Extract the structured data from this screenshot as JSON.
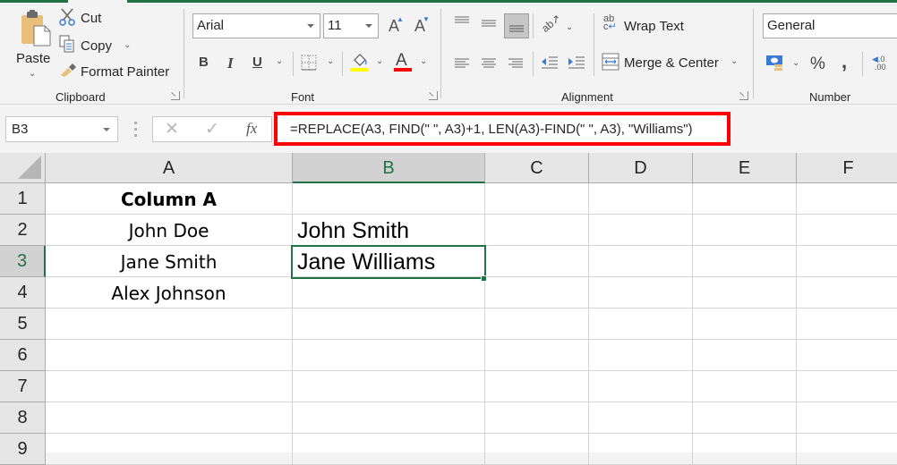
{
  "ribbon": {
    "clipboard": {
      "label": "Clipboard",
      "paste": "Paste",
      "cut": "Cut",
      "copy": "Copy",
      "format_painter": "Format Painter"
    },
    "font": {
      "label": "Font",
      "font_name": "Arial",
      "font_size": "11",
      "bold": "B",
      "italic": "I",
      "underline": "U",
      "grow": "A",
      "shrink": "A",
      "font_color_glyph": "A",
      "fill_color": "#ffff00",
      "font_color": "#ff0000"
    },
    "alignment": {
      "label": "Alignment",
      "wrap_text": "Wrap Text",
      "merge_center": "Merge & Center"
    },
    "number": {
      "label": "Number",
      "format": "General",
      "percent": "%",
      "comma": ",",
      "increase_decimal": ".00"
    }
  },
  "formula_bar": {
    "name_box": "B3",
    "cancel": "✕",
    "enter": "✓",
    "fx": "fx",
    "formula": "=REPLACE(A3, FIND(\" \", A3)+1, LEN(A3)-FIND(\" \", A3), \"Williams\")"
  },
  "sheet": {
    "columns": [
      "A",
      "B",
      "C",
      "D",
      "E",
      "F"
    ],
    "rows": [
      "1",
      "2",
      "3",
      "4",
      "5",
      "6",
      "7",
      "8",
      "9"
    ],
    "selected_cell": "B3",
    "cells": {
      "A1": "Column A",
      "A2": "John Doe",
      "A3": "Jane Smith",
      "A4": "Alex Johnson",
      "B2": "John Smith",
      "B3": "Jane Williams"
    }
  },
  "colors": {
    "accent": "#217346",
    "highlight_box": "#ff0000"
  }
}
